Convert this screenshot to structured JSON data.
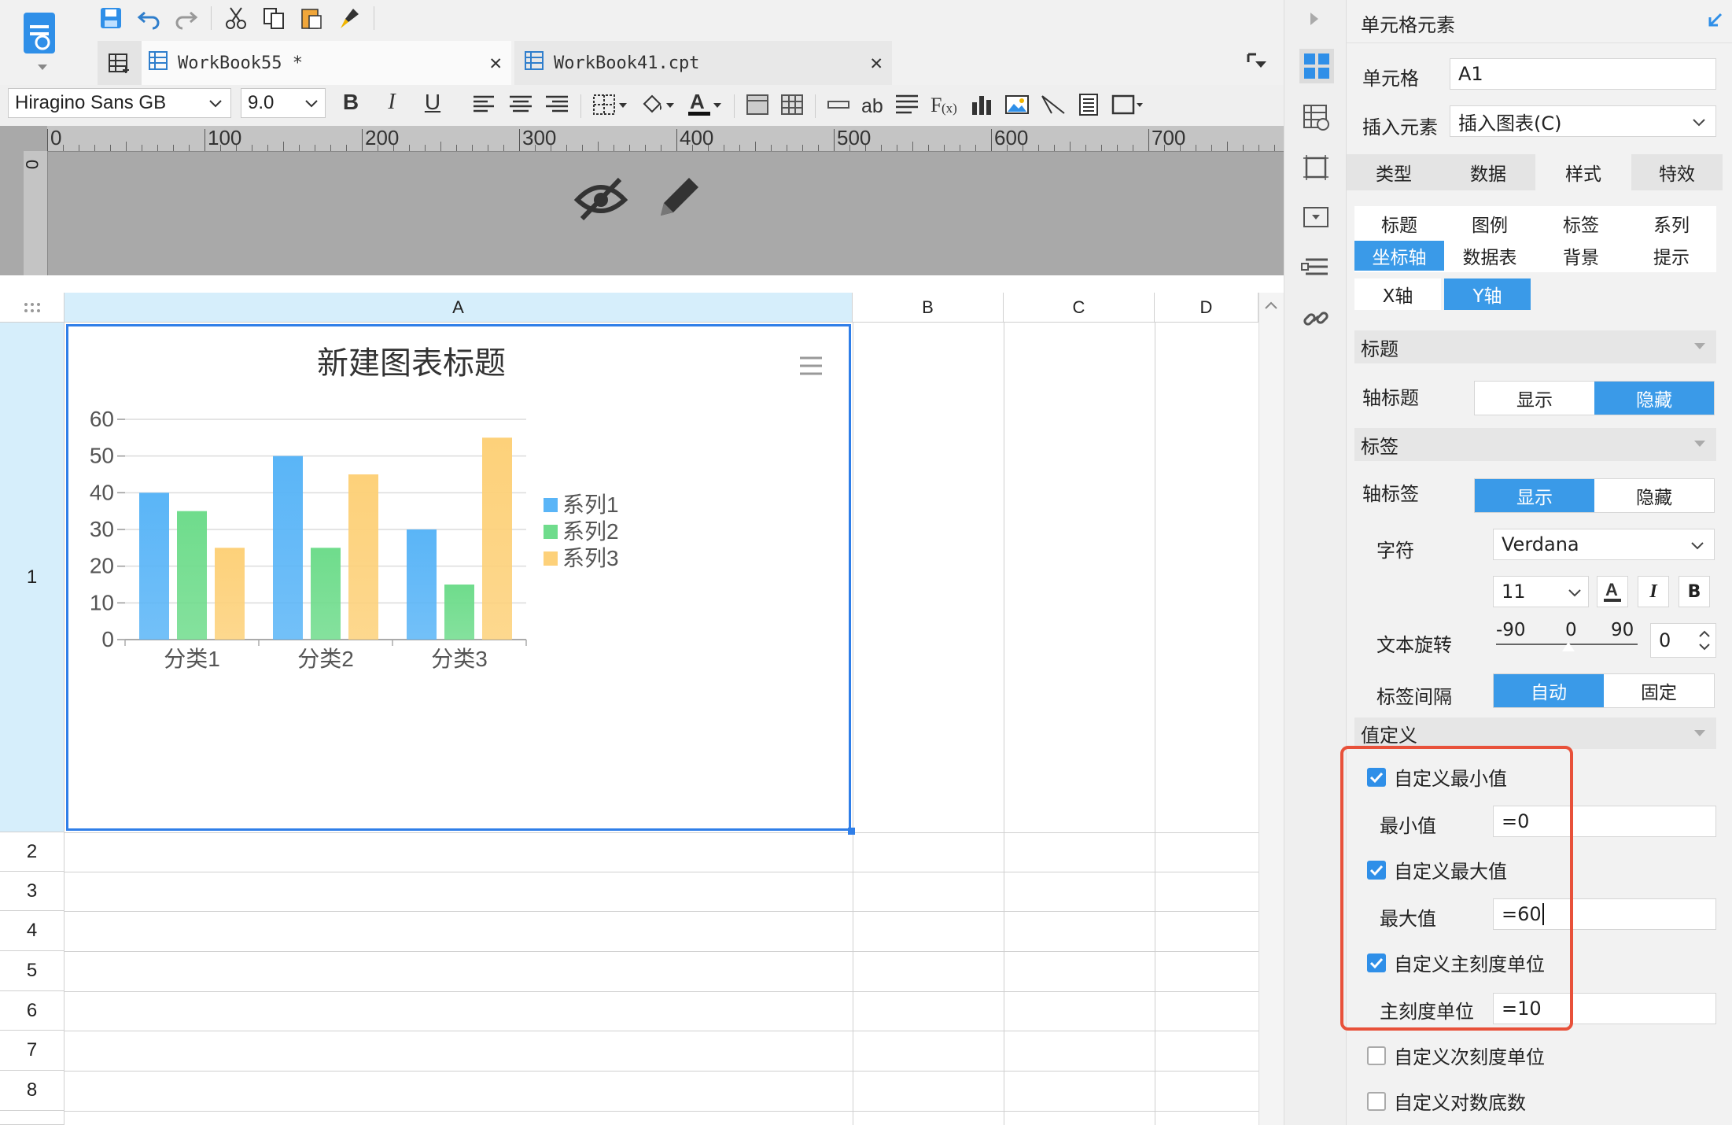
{
  "tabs": [
    {
      "label": "WorkBook55  *"
    },
    {
      "label": "WorkBook41.cpt"
    }
  ],
  "format_bar": {
    "font": "Hiragino Sans GB",
    "size": "9.0",
    "bold": "B",
    "italic": "I",
    "underline": "U",
    "wrap": "ab"
  },
  "ruler": {
    "ticks": [
      "0",
      "100",
      "200",
      "300",
      "400",
      "500",
      "600",
      "700"
    ],
    "v_zero": "0"
  },
  "grid": {
    "columns": [
      "A",
      "B",
      "C",
      "D"
    ],
    "rows": [
      "1",
      "2",
      "3",
      "4",
      "5",
      "6",
      "7",
      "8"
    ]
  },
  "chart_data": {
    "type": "bar",
    "title": "新建图表标题",
    "categories": [
      "分类1",
      "分类2",
      "分类3"
    ],
    "series": [
      {
        "name": "系列1",
        "values": [
          40,
          50,
          30
        ],
        "color": "#5ab5f7"
      },
      {
        "name": "系列2",
        "values": [
          35,
          25,
          15
        ],
        "color": "#6fdc8c"
      },
      {
        "name": "系列3",
        "values": [
          25,
          45,
          55
        ],
        "color": "#fdd17a"
      }
    ],
    "yticks": [
      "0",
      "10",
      "20",
      "30",
      "40",
      "50",
      "60"
    ],
    "ylim": [
      0,
      60
    ],
    "legend": "right"
  },
  "panel": {
    "header": "单元格元素",
    "cell_label": "单元格",
    "cell_value": "A1",
    "insert_label": "插入元素",
    "insert_value": "插入图表(C)",
    "main_tabs": [
      "类型",
      "数据",
      "样式",
      "特效"
    ],
    "sub_tabs_row1": [
      "标题",
      "图例",
      "标签",
      "系列"
    ],
    "sub_tabs_row2": [
      "坐标轴",
      "数据表",
      "背景",
      "提示"
    ],
    "axis_tabs": [
      "X轴",
      "Y轴"
    ],
    "section_title": "标题",
    "axis_title_label": "轴标题",
    "show": "显示",
    "hide": "隐藏",
    "section_label": "标签",
    "axis_label_label": "轴标签",
    "char_label": "字符",
    "font_value": "Verdana",
    "font_size": "11",
    "bold": "B",
    "italic": "I",
    "rotate_label": "文本旋转",
    "rotate_min": "-90",
    "rotate_mid": "0",
    "rotate_max": "90",
    "rotate_value": "0",
    "interval_label": "标签间隔",
    "auto": "自动",
    "fixed": "固定",
    "value_def": "值定义",
    "custom_min": "自定义最小值",
    "min_label": "最小值",
    "min_value": "=0",
    "custom_max": "自定义最大值",
    "max_label": "最大值",
    "max_value": "=60",
    "custom_major": "自定义主刻度单位",
    "major_label": "主刻度单位",
    "major_value": "=10",
    "custom_minor": "自定义次刻度单位",
    "custom_log": "自定义对数底数"
  }
}
